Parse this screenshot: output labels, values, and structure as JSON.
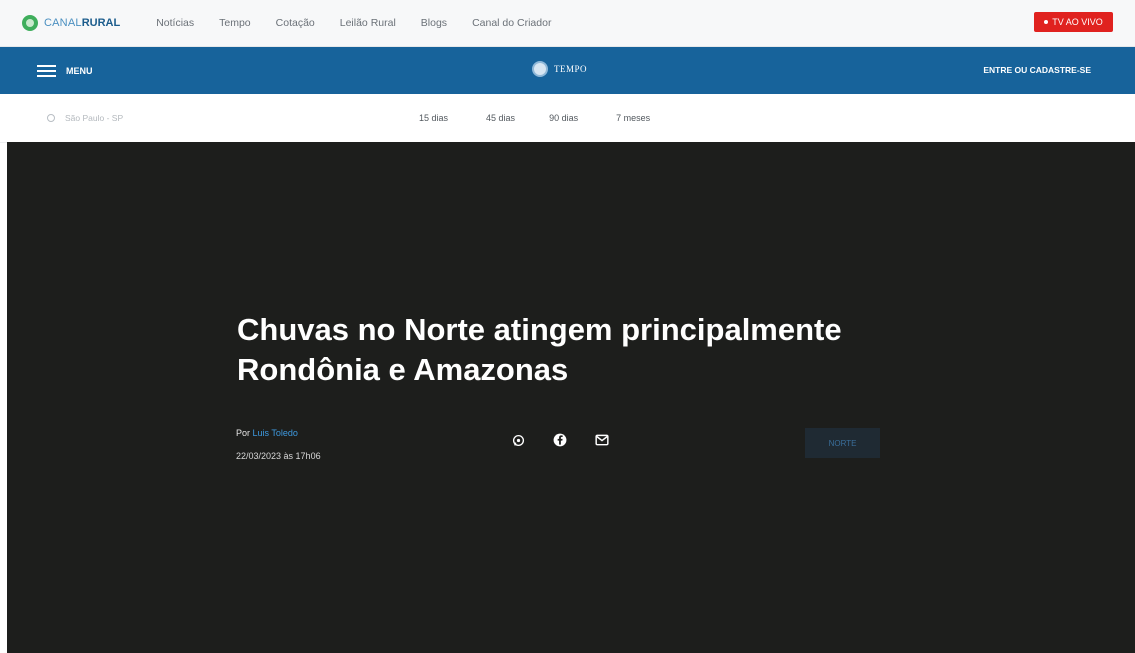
{
  "topbar": {
    "logo": {
      "prefix": "CANAL",
      "suffix": "RURAL"
    },
    "nav": [
      "Notícias",
      "Tempo",
      "Cotação",
      "Leilão Rural",
      "Blogs",
      "Canal do Criador"
    ],
    "live_label": "TV AO VIVO"
  },
  "bluebar": {
    "menu_label": "MENU",
    "section_label": "TEMPO",
    "login_label": "ENTRE OU CADASTRE-SE"
  },
  "forecast": {
    "city": "São Paulo - SP",
    "periods": [
      "15 dias",
      "45 dias",
      "90 dias",
      "7 meses"
    ]
  },
  "article": {
    "headline": "Chuvas no Norte atingem principalmente Rondônia e Amazonas",
    "by_prefix": "Por",
    "author": "Luis Toledo",
    "date": "22/03/2023 às 17h06",
    "tag": "NORTE"
  },
  "colors": {
    "brand_blue": "#17639b",
    "live_red": "#e0221f",
    "hero_bg": "#1d1e1c",
    "author_link": "#3e9ae0"
  },
  "icons": {
    "logo": "canal-rural-logo-icon",
    "menu": "hamburger-icon",
    "section": "tempo-icon",
    "city": "location-icon",
    "share": [
      "whatsapp-icon",
      "facebook-icon",
      "email-icon"
    ]
  }
}
